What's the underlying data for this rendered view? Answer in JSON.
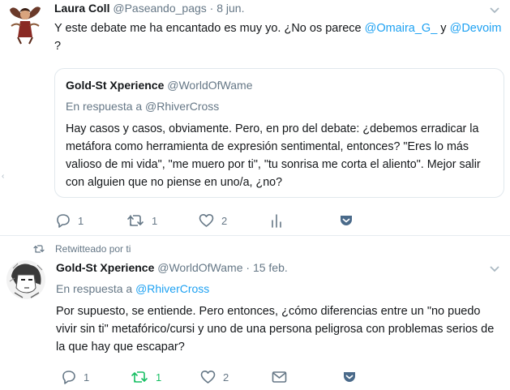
{
  "tweet1": {
    "name": "Laura Coll",
    "handle": "@Paseando_pags",
    "dot": "·",
    "date": "8 jun.",
    "text_before": "Y este debate me ha encantado es muy yo. ¿No os parece ",
    "mention1": "@Omaira_G_",
    "text_between": " y ",
    "mention2": "@Devoim",
    "text_after": "?",
    "quote": {
      "name": "Gold-St Xperience",
      "handle": "@WorldOfWame",
      "replying": "En respuesta a @RhiverCross",
      "text": "Hay casos y casos, obviamente. Pero, en pro del debate: ¿debemos erradicar la metáfora como herramienta de expresión sentimental, entonces? \"Eres lo más valioso de mi vida\", \"me muero por ti\", \"tu sonrisa me corta el aliento\". Mejor salir con alguien que no piense en uno/a, ¿no?"
    },
    "replies": "1",
    "retweets": "1",
    "likes": "2"
  },
  "tweet2": {
    "retweet_label": "Retwitteado por ti",
    "name": "Gold-St Xperience",
    "handle": "@WorldOfWame",
    "dot": "·",
    "date": "15 feb.",
    "replying_prefix": "En respuesta a ",
    "replying_mention": "@RhiverCross",
    "text": "Por supuesto, se entiende. Pero entonces, ¿cómo diferencias entre un \"no puedo vivir sin ti\" metafórico/cursi y uno de una persona peligrosa con problemas serios de la que hay que escapar?",
    "replies": "1",
    "retweets": "1",
    "likes": "2"
  },
  "colors": {
    "accent": "#1da1f2",
    "retweet_active": "#17bf63",
    "muted": "#657786",
    "border": "#e6ecf0"
  },
  "icons": [
    "reply-icon",
    "retweet-icon",
    "heart-icon",
    "analytics-icon",
    "message-icon",
    "caret-down-icon"
  ]
}
